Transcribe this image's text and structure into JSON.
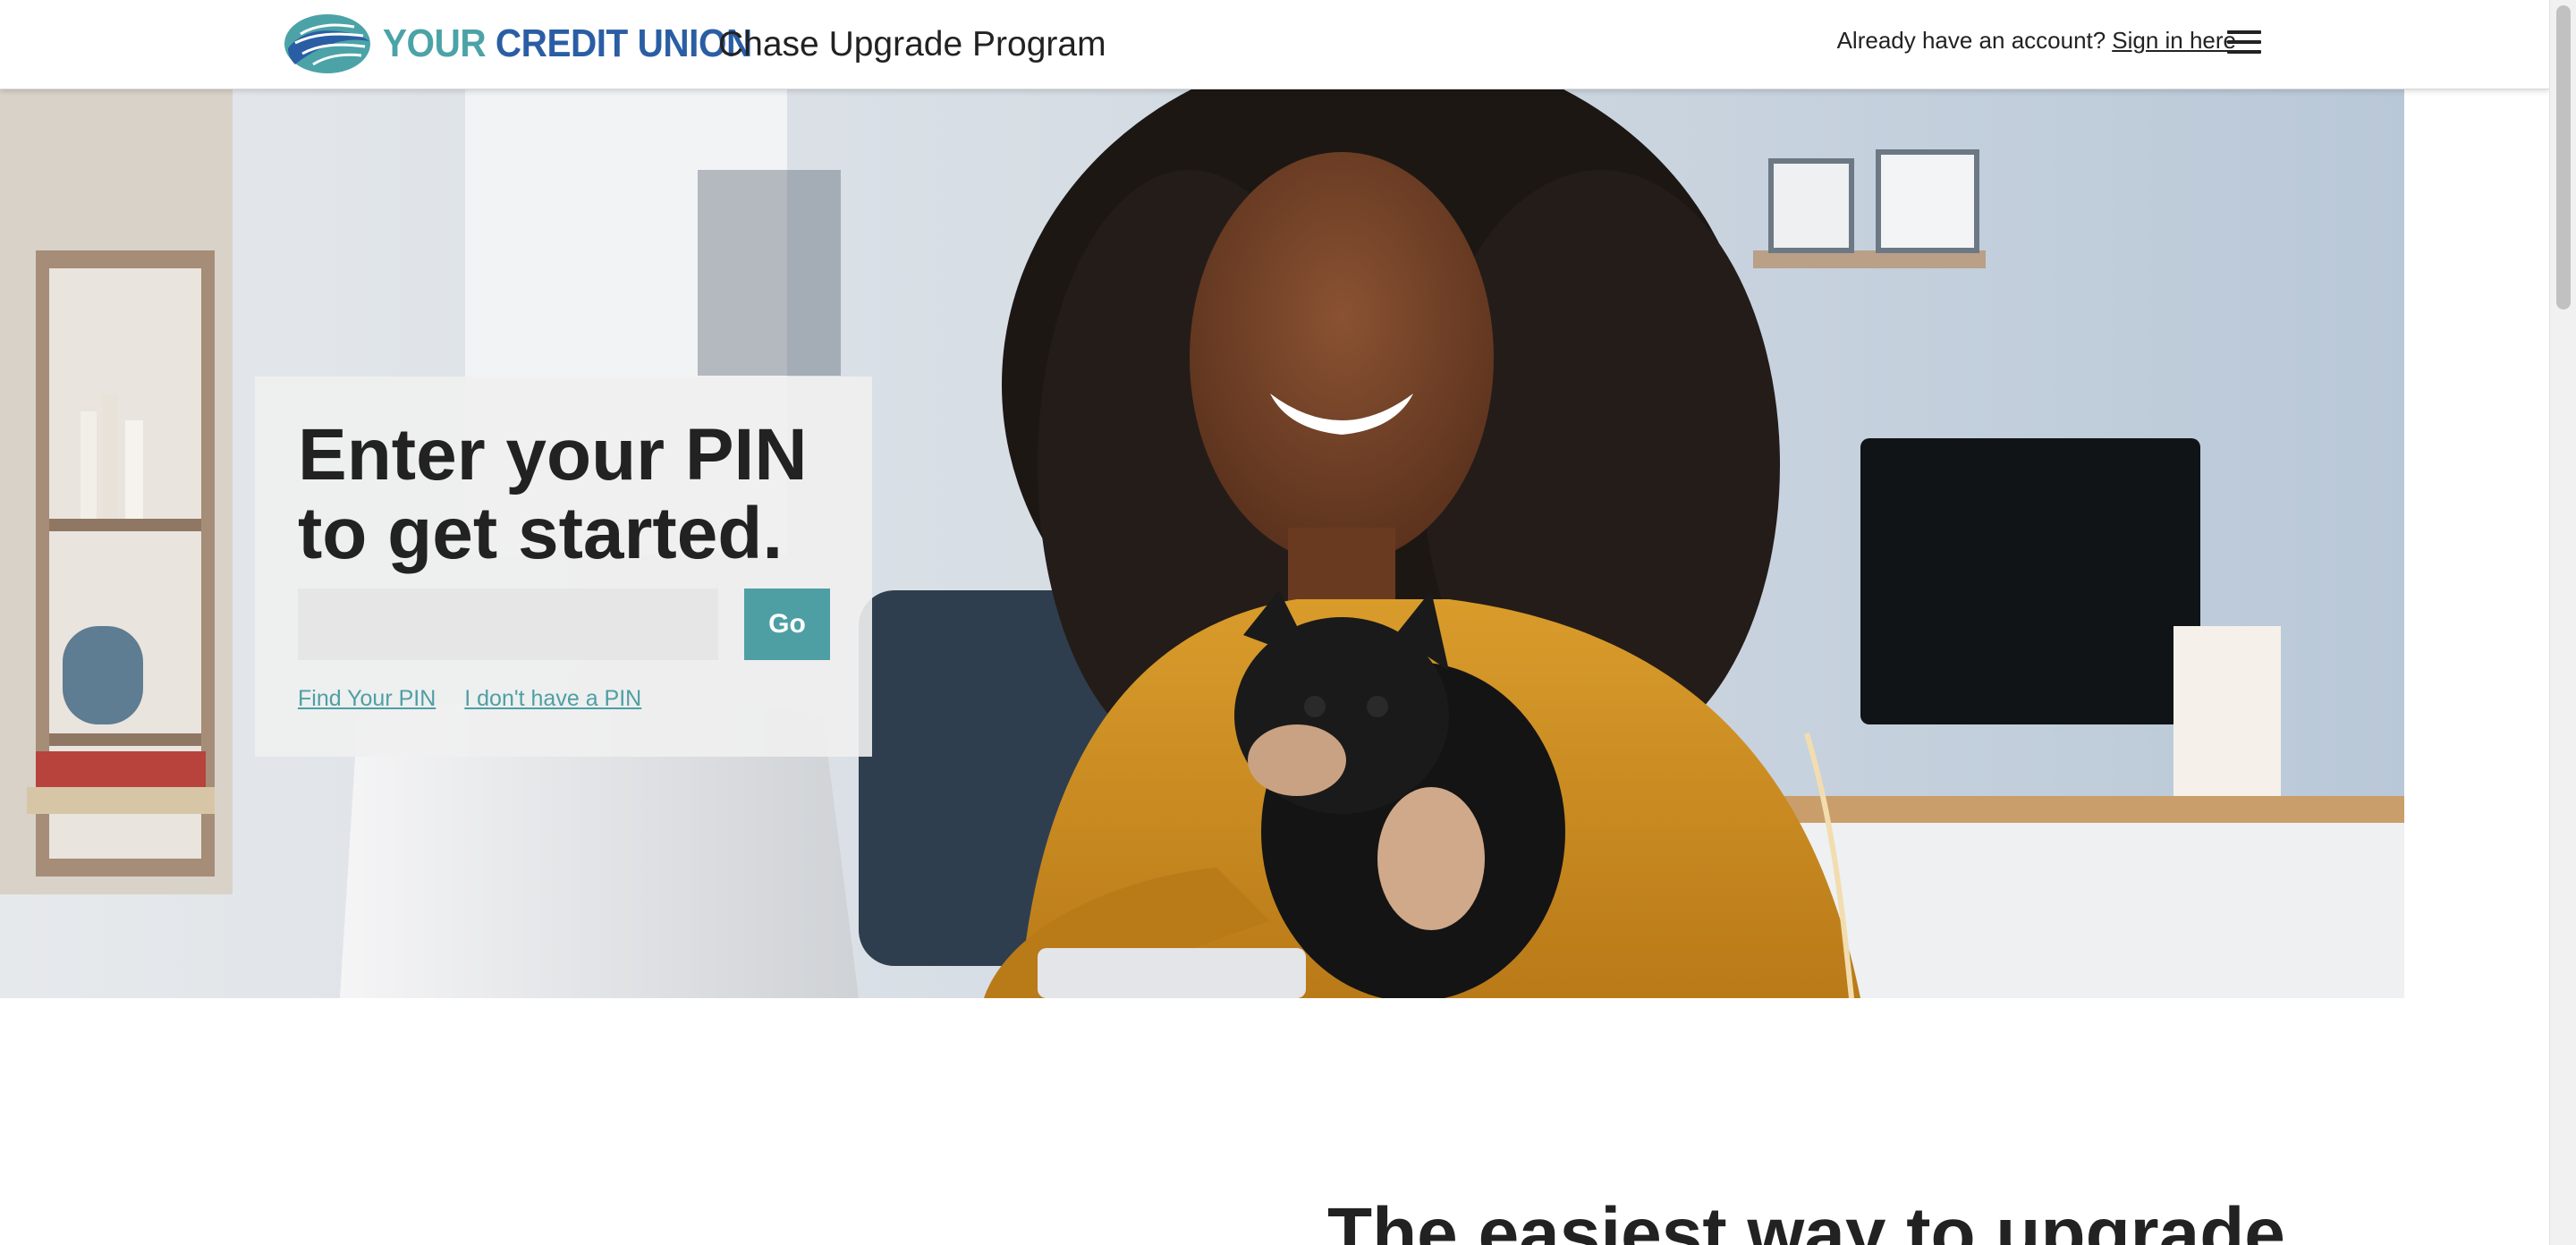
{
  "header": {
    "logo": {
      "word1": "YOUR",
      "word2": "CREDIT UNION"
    },
    "program_title": "Chase Upgrade Program",
    "account_prompt": "Already have an account?",
    "signin_label": "Sign in here",
    "menu_icon": "hamburger-menu-icon"
  },
  "hero": {
    "image_subject": "woman-with-dog-at-laptop-photo",
    "pin_card": {
      "heading_line1": "Enter your PIN",
      "heading_line2": "to get started.",
      "input_value": "",
      "input_placeholder": "",
      "go_label": "Go",
      "find_pin_label": "Find Your PIN",
      "no_pin_label": "I don't have a PIN"
    }
  },
  "lower": {
    "heading": "The easiest way to upgrade"
  },
  "colors": {
    "accent_teal": "#4e9fa4",
    "logo_teal": "#4ba3a7",
    "logo_blue": "#2a5ea4",
    "heading_dark": "#222222"
  }
}
